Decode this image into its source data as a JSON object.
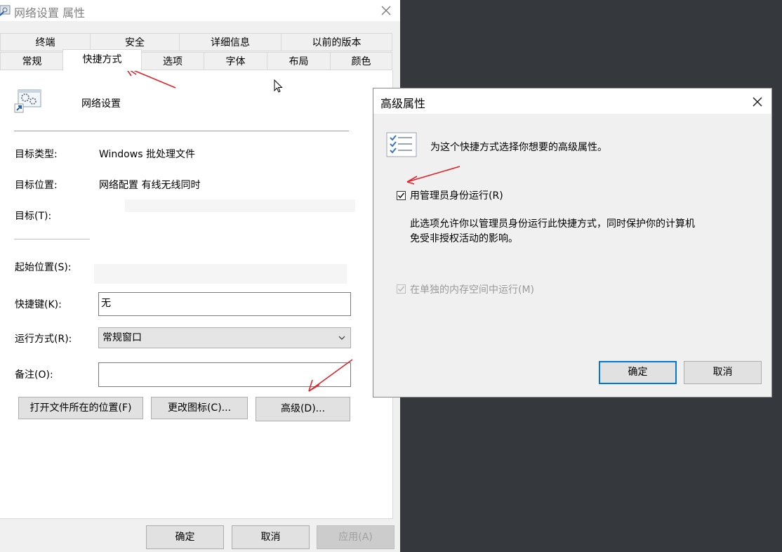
{
  "main_window": {
    "title": "网络设置 属性",
    "tabs_row1": [
      "终端",
      "安全",
      "详细信息",
      "以前的版本"
    ],
    "tabs_row2": [
      "常规",
      "快捷方式",
      "选项",
      "字体",
      "布局",
      "颜色"
    ],
    "active_tab": "快捷方式",
    "shortcut_name": "网络设置",
    "target_type_label": "目标类型:",
    "target_type_value": "Windows 批处理文件",
    "target_location_label": "目标位置:",
    "target_location_value": "网络配置 有线无线同时",
    "target_label": "目标(T):",
    "start_in_label": "起始位置(S):",
    "hotkey_label": "快捷键(K):",
    "hotkey_value": "无",
    "run_label": "运行方式(R):",
    "run_value": "常规窗口",
    "comment_label": "备注(O):",
    "comment_value": "",
    "open_location_button": "打开文件所在的位置(F)",
    "change_icon_button": "更改图标(C)...",
    "advanced_button": "高级(D)...",
    "ok_button": "确定",
    "cancel_button": "取消",
    "apply_button": "应用(A)"
  },
  "advanced_dialog": {
    "title": "高级属性",
    "description": "为这个快捷方式选择你想要的高级属性。",
    "run_as_admin_label": "用管理员身份运行(R)",
    "run_as_admin_checked": true,
    "explanation_line1": "此选项允许你以管理员身份运行此快捷方式，同时保护你的计算机",
    "explanation_line2": "免受非授权活动的影响。",
    "separate_memory_label": "在单独的内存空间中运行(M)",
    "separate_memory_checked": true,
    "separate_memory_disabled": true,
    "ok_button": "确定",
    "cancel_button": "取消"
  },
  "colors": {
    "desktop": "#35393d",
    "window_bg": "#f0f0f0",
    "accent": "#0078d7",
    "annotation_arrow": "#e0242a"
  }
}
